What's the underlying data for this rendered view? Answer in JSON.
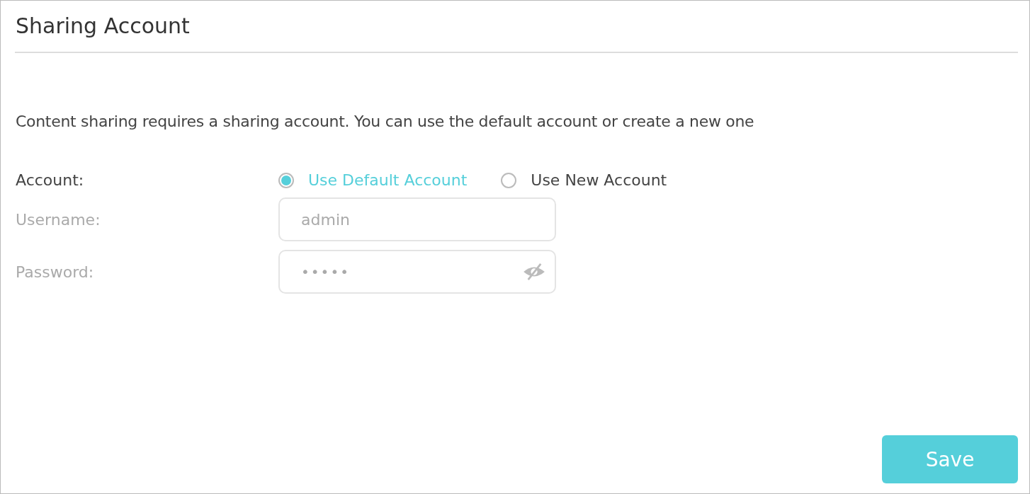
{
  "title": "Sharing Account",
  "description": "Content sharing requires a sharing account. You can use the default account or create a new one",
  "account": {
    "label": "Account:",
    "options": [
      {
        "label": "Use Default Account",
        "selected": true
      },
      {
        "label": "Use New Account",
        "selected": false
      }
    ]
  },
  "fields": [
    {
      "kind": "text",
      "label": "Username:",
      "value": "admin",
      "disabled": true
    },
    {
      "kind": "password",
      "label": "Password:",
      "value": "•••••",
      "disabled": true
    }
  ],
  "buttons": [
    {
      "label": "Save"
    }
  ]
}
